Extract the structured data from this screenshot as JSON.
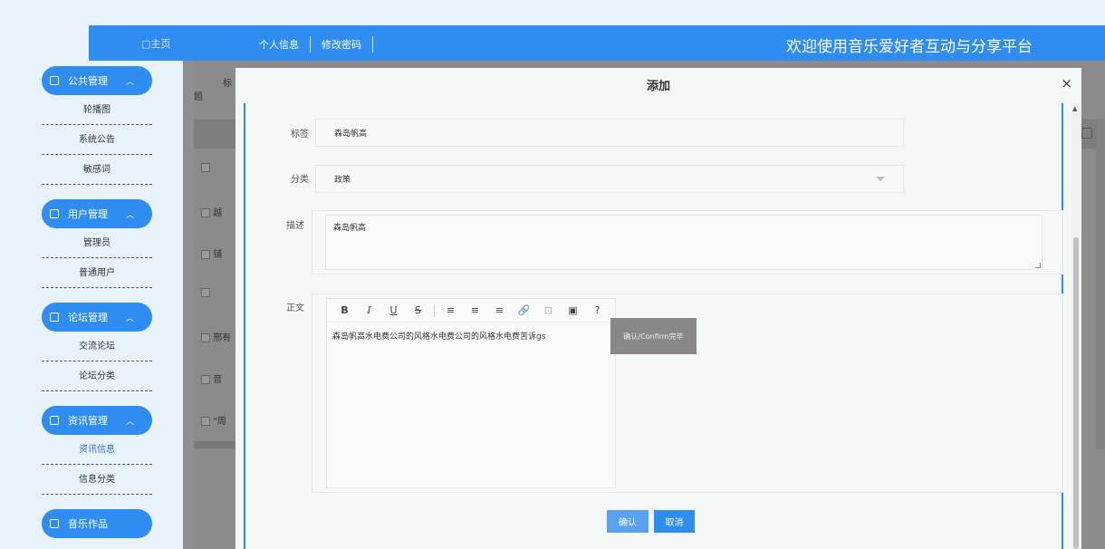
{
  "header": {
    "home_label": "▢主页",
    "nav": [
      "个人信息",
      "修改密码"
    ],
    "site_title": "欢迎使用音乐爱好者互动与分享平台"
  },
  "sidebar": {
    "groups": [
      {
        "title": "公共管理",
        "items": [
          "轮播图",
          "系统公告",
          "敏感词"
        ]
      },
      {
        "title": "用户管理",
        "items": [
          "管理员",
          "普通用户"
        ]
      },
      {
        "title": "论坛管理",
        "items": [
          "交流论坛",
          "论坛分类"
        ]
      },
      {
        "title": "资讯管理",
        "items": [
          "资讯信息",
          "信息分类"
        ],
        "active_item": "资讯信息"
      },
      {
        "title": "音乐作品",
        "items": []
      }
    ]
  },
  "background_table": {
    "header_fragment": "标题",
    "row_fragments": [
      "越",
      "铺",
      "",
      "邢有",
      "音",
      "\"周"
    ]
  },
  "modal": {
    "title": "添加",
    "close": "×",
    "fields": {
      "tag_label": "标签",
      "tag_value": "森岛帆高",
      "category_label": "分类",
      "category_value": "政策",
      "desc_label": "描述",
      "desc_value": "森岛帆高",
      "body_label": "正文",
      "body_value": "森岛帆高水电费公司的风格水电费公司的风格水电费苦诉gs"
    },
    "toolbar": [
      "B",
      "I",
      "U",
      "S",
      "≡",
      "≡",
      "≡",
      "🔗",
      "⊡",
      "▣",
      "?"
    ],
    "tooltip": "确认/Confirm完毕",
    "buttons": {
      "ok": "确认",
      "cancel": "取消"
    }
  }
}
